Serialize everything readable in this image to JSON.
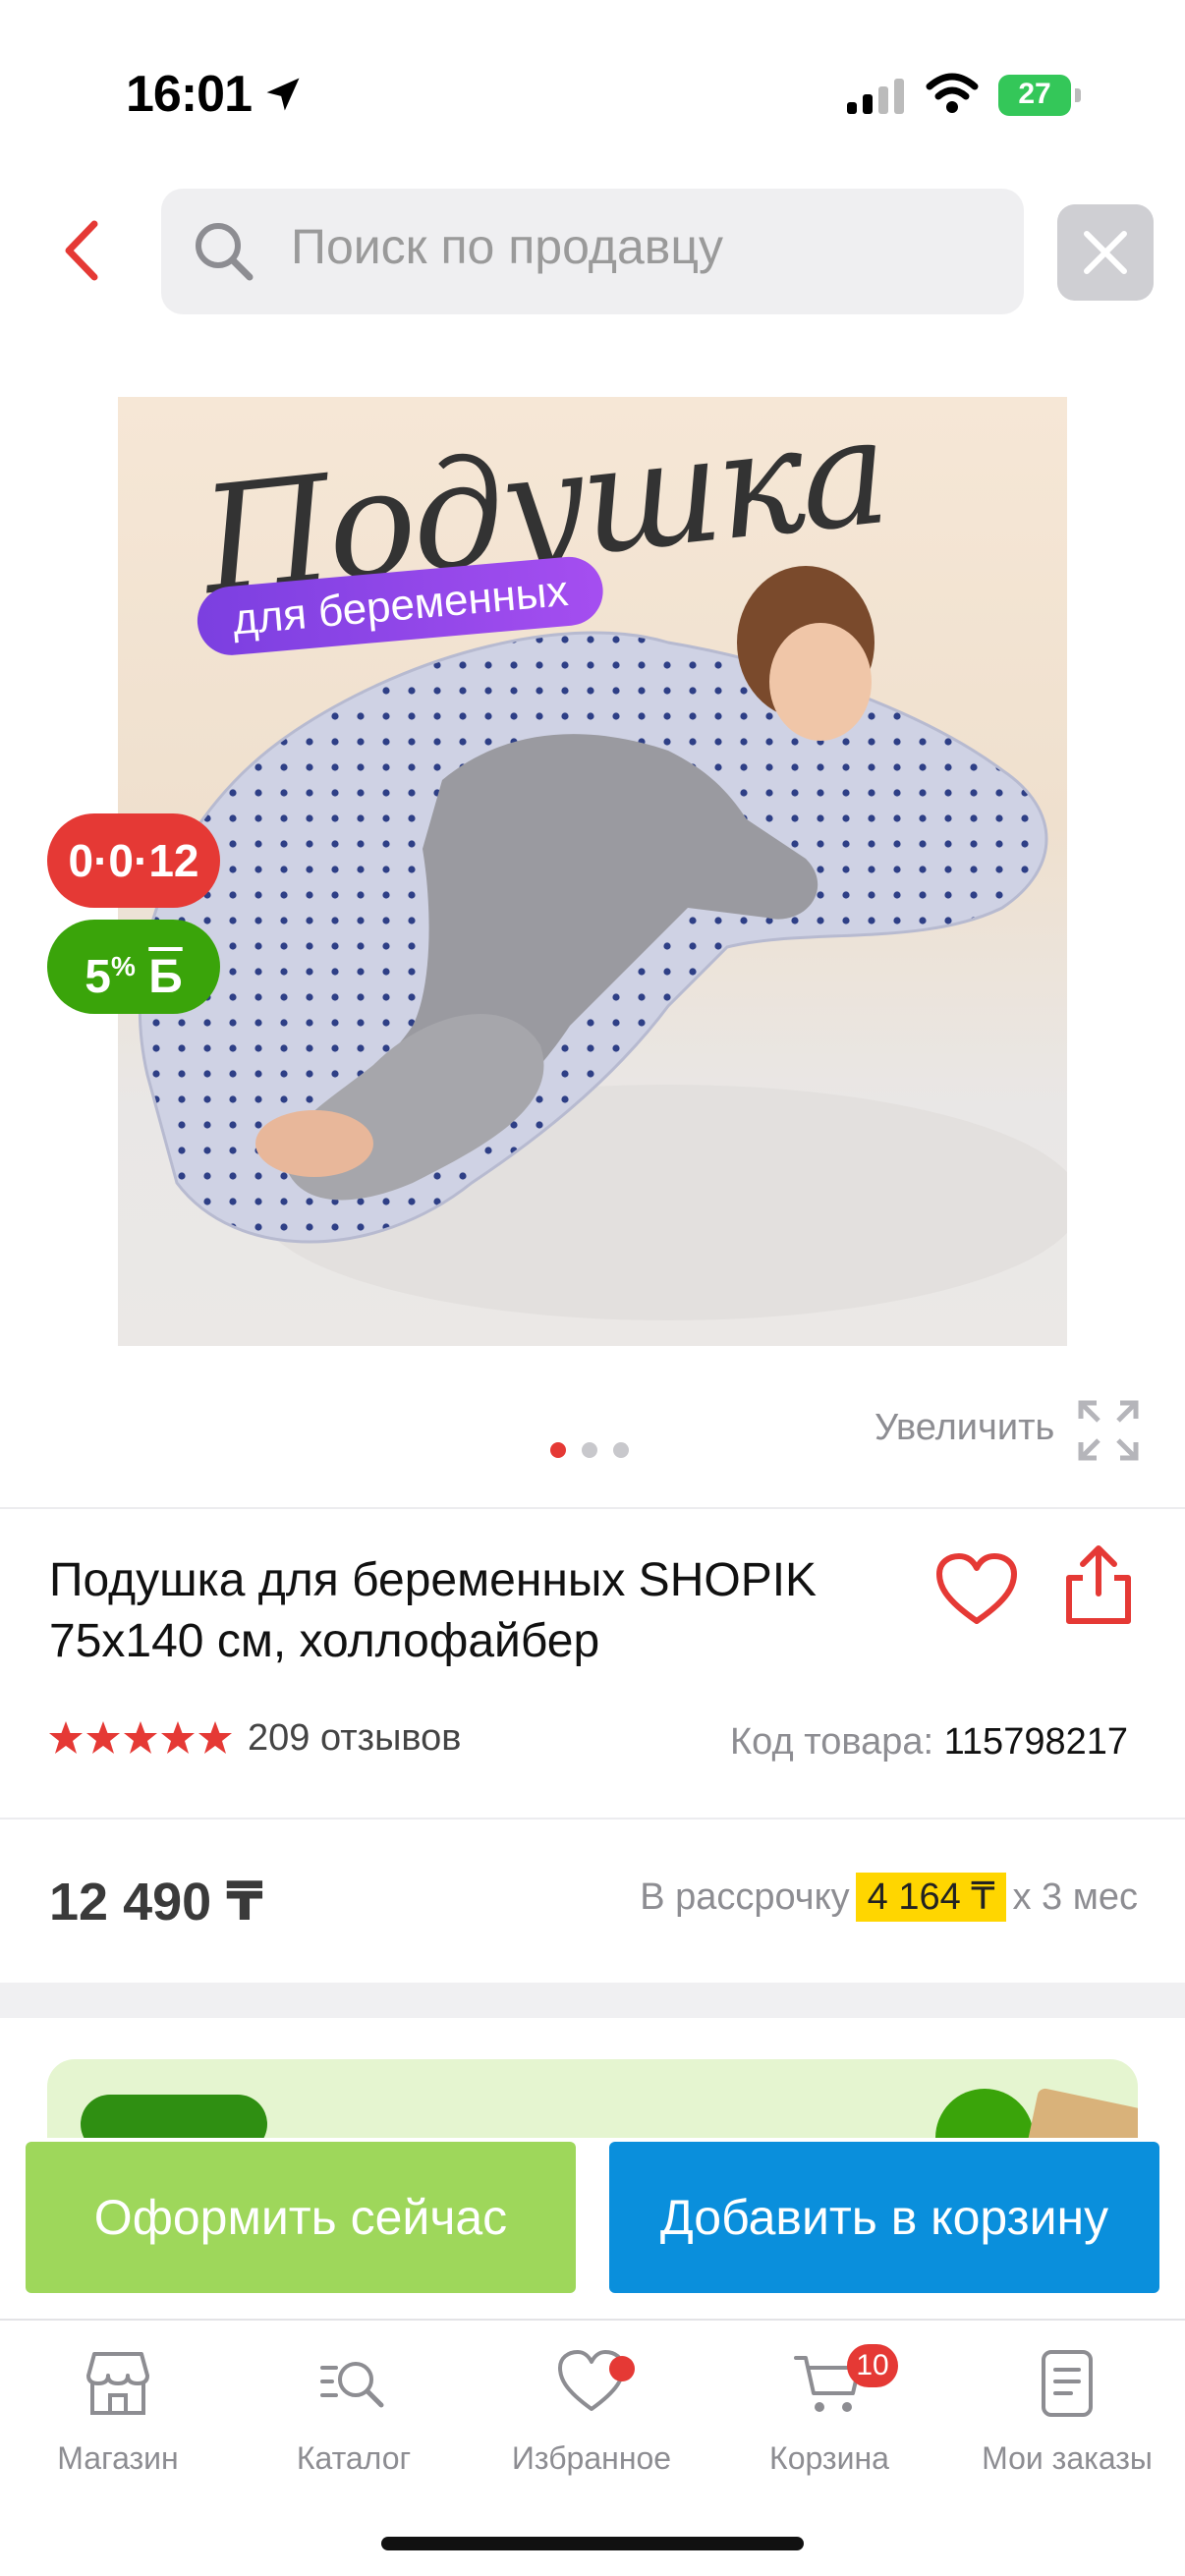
{
  "status_bar": {
    "time": "16:01",
    "battery": "27"
  },
  "header": {
    "search_placeholder": "Поиск по продавцу"
  },
  "gallery": {
    "image_title": "Подушка",
    "image_subtitle": "для беременных",
    "badge_installment": "0·0·12",
    "badge_bonus_value": "5",
    "badge_bonus_suffix": "%",
    "badge_bonus_letter": "Б",
    "zoom_label": "Увеличить",
    "dots_total": 3,
    "active_dot": 1
  },
  "product": {
    "title": "Подушка для беременных SHOPIK 75х140 см, холлофайбер",
    "rating": 5,
    "reviews": "209 отзывов",
    "sku_label": "Код товара:",
    "sku_value": "115798217",
    "price": "12 490 ₸",
    "installment_label": "В рассрочку",
    "installment_amount": "4 164 ₸",
    "installment_term": "х 3 мес"
  },
  "actions": {
    "buy_now": "Оформить сейчас",
    "add_to_cart": "Добавить в корзину"
  },
  "tab_bar": {
    "items": [
      {
        "label": "Магазин",
        "icon": "store-icon"
      },
      {
        "label": "Каталог",
        "icon": "catalog-icon"
      },
      {
        "label": "Избранное",
        "icon": "heart-icon"
      },
      {
        "label": "Корзина",
        "icon": "cart-icon"
      },
      {
        "label": "Мои заказы",
        "icon": "orders-icon"
      }
    ],
    "cart_count": "10"
  },
  "colors": {
    "accent_red": "#e53935",
    "buy_green": "#9ed75b",
    "cart_blue": "#0a8fdc",
    "bonus_green": "#3aa40a",
    "installment_yellow": "#ffd600"
  }
}
